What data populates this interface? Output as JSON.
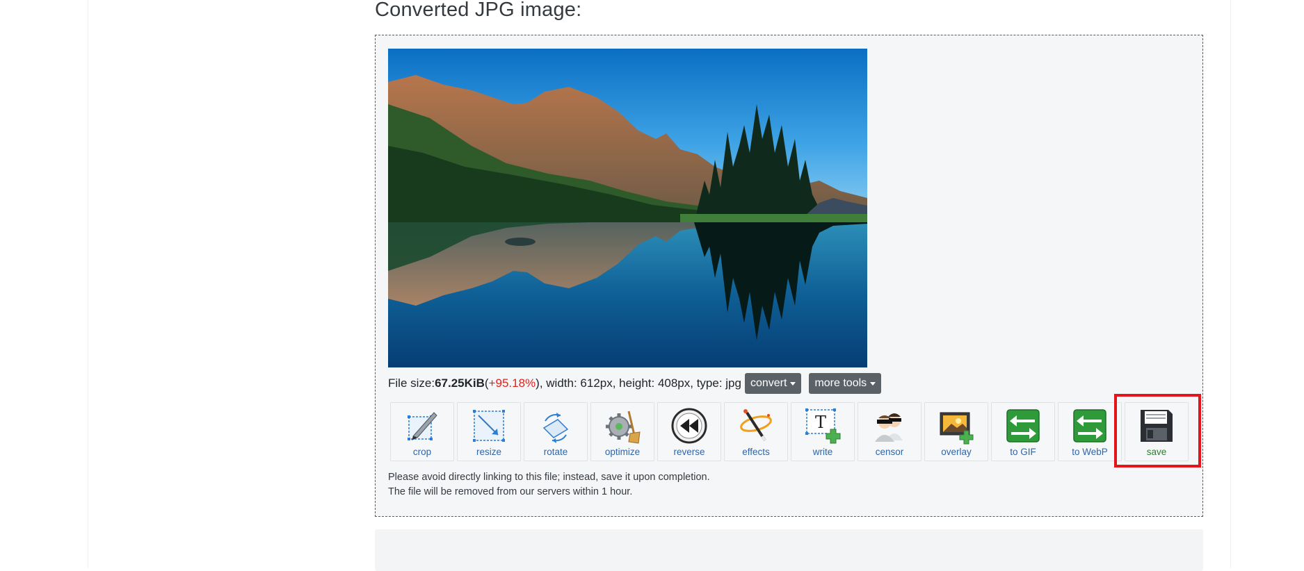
{
  "heading": "Converted JPG image:",
  "image": {
    "alt": "Mountain lake with forest and island reflection"
  },
  "file_info": {
    "size_label": "File size: ",
    "size_value": "67.25KiB",
    "paren_open": " (",
    "change": "+95.18%",
    "rest": "), width: 612px, height: 408px, type: jpg"
  },
  "buttons": {
    "convert": "convert",
    "more_tools": "more tools"
  },
  "tools": [
    {
      "label": "crop",
      "icon": "crop-icon"
    },
    {
      "label": "resize",
      "icon": "resize-icon"
    },
    {
      "label": "rotate",
      "icon": "rotate-icon"
    },
    {
      "label": "optimize",
      "icon": "optimize-icon"
    },
    {
      "label": "reverse",
      "icon": "reverse-icon"
    },
    {
      "label": "effects",
      "icon": "effects-icon"
    },
    {
      "label": "write",
      "icon": "write-icon"
    },
    {
      "label": "censor",
      "icon": "censor-icon"
    },
    {
      "label": "overlay",
      "icon": "overlay-icon"
    },
    {
      "label": "to GIF",
      "icon": "to-gif-icon"
    },
    {
      "label": "to WebP",
      "icon": "to-webp-icon"
    },
    {
      "label": "save",
      "icon": "floppy-disk-icon"
    }
  ],
  "notice": {
    "line1": "Please avoid directly linking to this file; instead, save it upon completion.",
    "line2": "The file will be removed from our servers within 1 hour."
  },
  "colors": {
    "accent_link": "#2f65a7",
    "highlight": "#e3141c",
    "change_text": "#e3211c",
    "dropdown_button": "#5a6268"
  }
}
